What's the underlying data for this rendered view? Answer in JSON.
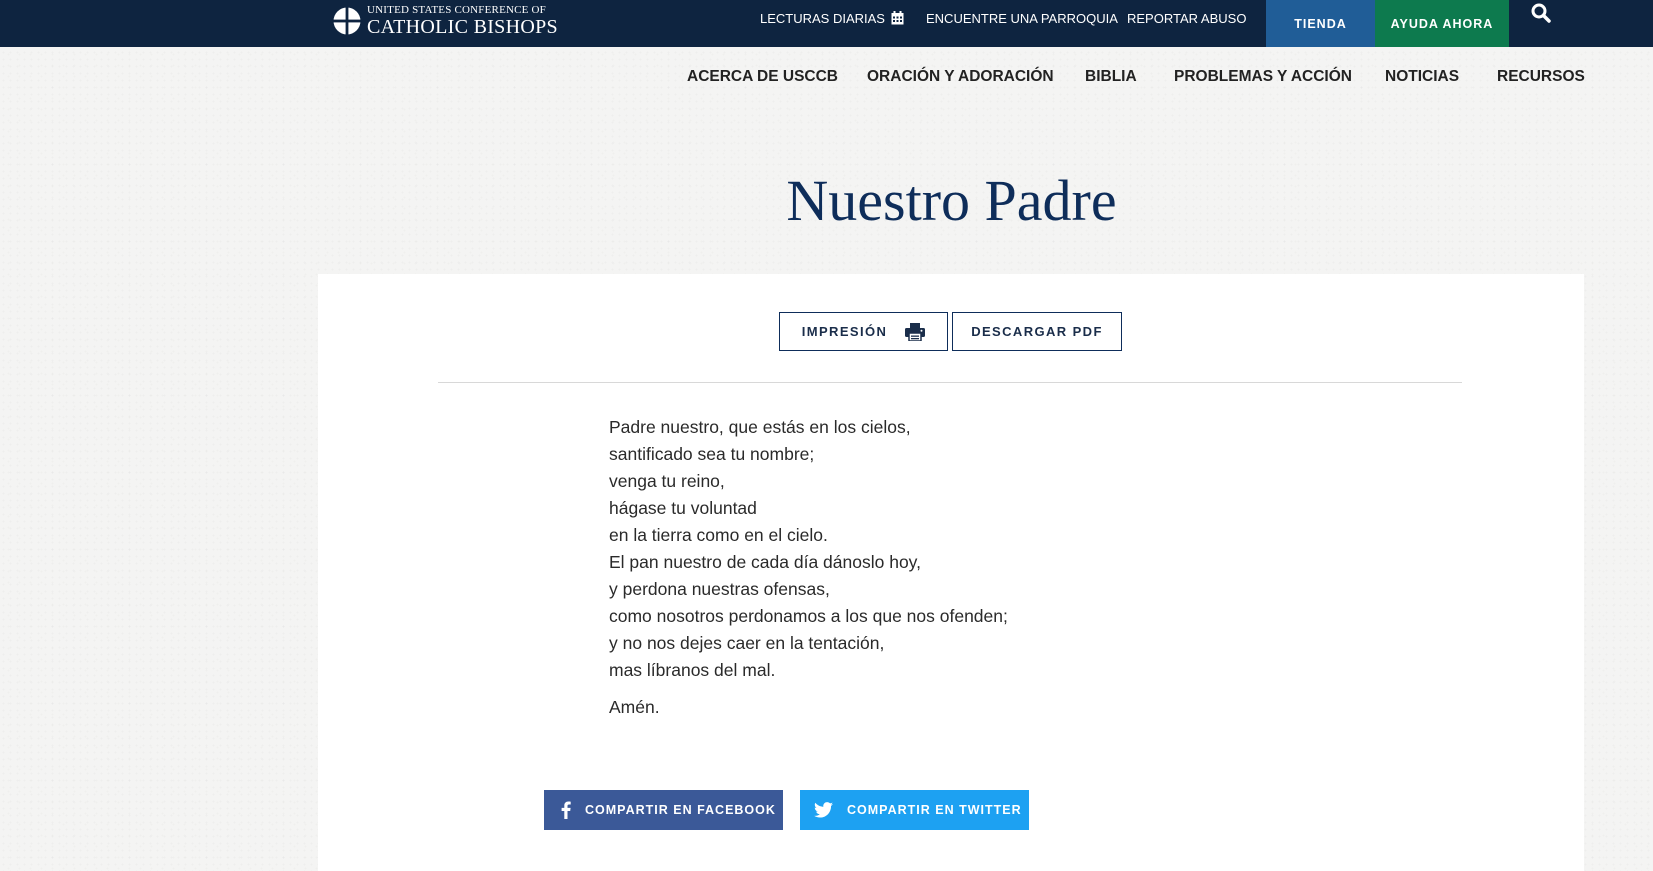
{
  "header": {
    "logo_line1": "UNITED STATES CONFERENCE OF",
    "logo_line2": "CATHOLIC BISHOPS",
    "utility_links": {
      "daily_readings": "LECTURAS DIARIAS",
      "find_parish": "ENCUENTRE UNA PARROQUIA",
      "report_abuse": "REPORTAR ABUSO"
    },
    "store_label": "TIENDA",
    "help_label": "AYUDA AHORA",
    "icons": [
      "calendar-icon",
      "search-icon"
    ],
    "colors": {
      "bar": "#0e2440",
      "store": "#205d97",
      "help": "#0d7a4e"
    }
  },
  "main_nav": {
    "about": "ACERCA DE USCCB",
    "prayer": "ORACIÓN Y ADORACIÓN",
    "bible": "BIBLIA",
    "issues": "PROBLEMAS Y ACCIÓN",
    "news": "NOTICIAS",
    "resources": "RECURSOS"
  },
  "page": {
    "title": "Nuestro Padre",
    "print_label": "IMPRESIÓN",
    "pdf_label": "DESCARGAR PDF",
    "prayer_lines": [
      "Padre nuestro, que estás en los cielos,",
      "santificado sea tu nombre;",
      "venga tu reino,",
      "hágase tu voluntad",
      "en la tierra como en el cielo.",
      "El pan nuestro de cada día dánoslo hoy,",
      "y perdona nuestras ofensas,",
      "como nosotros perdonamos a los que nos ofenden;",
      "y no nos dejes caer en la tentación,",
      "mas líbranos del mal."
    ],
    "amen": "Amén.",
    "share_facebook": "COMPARTIR EN FACEBOOK",
    "share_twitter": "COMPARTIR EN TWITTER",
    "colors": {
      "title": "#0e2d5a",
      "facebook": "#3b5998",
      "twitter": "#1da1f2"
    }
  }
}
